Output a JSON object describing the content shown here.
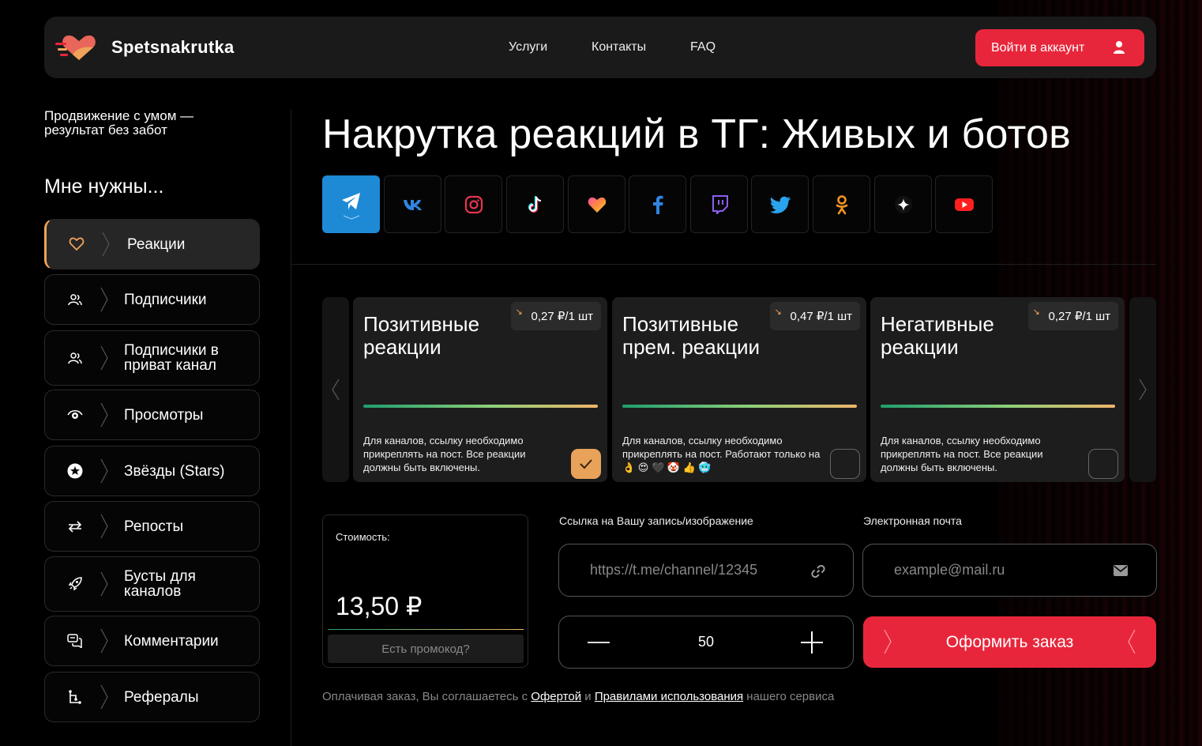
{
  "header": {
    "brand": "Spetsnakrutka",
    "nav": [
      "Услуги",
      "Контакты",
      "FAQ"
    ],
    "login_label": "Войти в аккаунт",
    "accent": "#e8263b"
  },
  "sidebar": {
    "tagline": "Продвижение с умом — результат без забот",
    "title": "Мне нужны...",
    "items": [
      {
        "label": "Реакции",
        "icon": "heart-icon",
        "active": true
      },
      {
        "label": "Подписчики",
        "icon": "users-icon"
      },
      {
        "label": "Подписчики в приват канал",
        "icon": "users-icon"
      },
      {
        "label": "Просмотры",
        "icon": "eye-icon"
      },
      {
        "label": "Звёзды (Stars)",
        "icon": "star-icon"
      },
      {
        "label": "Репосты",
        "icon": "repost-icon"
      },
      {
        "label": "Бусты для каналов",
        "icon": "rocket-icon"
      },
      {
        "label": "Комментарии",
        "icon": "comments-icon"
      },
      {
        "label": "Рефералы",
        "icon": "referral-icon"
      }
    ]
  },
  "main": {
    "title": "Накрутка реакций в ТГ: Живых и ботов",
    "networks": [
      "telegram-icon",
      "vk-icon",
      "instagram-icon",
      "tiktok-icon",
      "likee-icon",
      "facebook-icon",
      "twitch-icon",
      "twitter-icon",
      "odnoklassniki-icon",
      "threads-icon",
      "youtube-icon"
    ],
    "cards": [
      {
        "title": "Позитивные реакции",
        "price": "0,27 ₽/1 шт",
        "desc": "Для каналов, ссылку необходимо прикреплять на пост. Все реакции должны быть включены.",
        "selected": true
      },
      {
        "title": "Позитивные прем. реакции",
        "price": "0,47 ₽/1 шт",
        "desc": "Для каналов, ссылку необходимо прикреплять на пост. Работают только на 👌 😍 🖤 🤡 👍 🥶",
        "selected": false
      },
      {
        "title": "Негативные реакции",
        "price": "0,27 ₽/1 шт",
        "desc": "Для каналов, ссылку необходимо прикреплять на пост. Все реакции должны быть включены.",
        "selected": false
      }
    ]
  },
  "order": {
    "cost_label": "Стоимость:",
    "cost_value": "13,50 ₽",
    "promo_label": "Есть промокод?",
    "link_label": "Ссылка на Вашу запись/изображение",
    "link_placeholder": "https://t.me/channel/12345",
    "email_label": "Электронная почта",
    "email_placeholder": "example@mail.ru",
    "quantity": "50",
    "submit_label": "Оформить заказ",
    "agree_prefix": "Оплачивая заказ, Вы соглашаетесь с ",
    "offer_link": "Офертой",
    "agree_and": " и ",
    "rules_link": "Правилами использования",
    "agree_suffix": " нашего сервиса"
  }
}
